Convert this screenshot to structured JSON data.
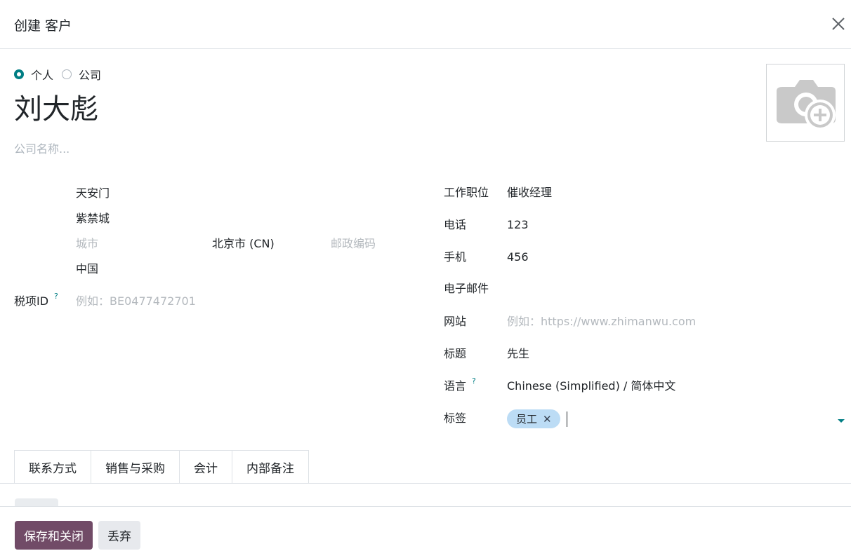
{
  "dialog": {
    "title": "创建 客户"
  },
  "type_options": [
    {
      "label": "个人",
      "selected": true
    },
    {
      "label": "公司",
      "selected": false
    }
  ],
  "name": "刘大彪",
  "company_placeholder": "公司名称...",
  "address": {
    "street": "天安门",
    "street2": "紫禁城",
    "city_placeholder": "城市",
    "state": "北京市 (CN)",
    "zip_placeholder": "邮政编码",
    "country": "中国"
  },
  "vat": {
    "label": "税项ID",
    "help": "?",
    "placeholder": "例如：BE0477472701"
  },
  "right_fields": {
    "job": {
      "label": "工作职位",
      "value": "催收经理"
    },
    "phone": {
      "label": "电话",
      "value": "123"
    },
    "mobile": {
      "label": "手机",
      "value": "456"
    },
    "email": {
      "label": "电子邮件",
      "value": ""
    },
    "website": {
      "label": "网站",
      "placeholder": "例如：https://www.zhimanwu.com"
    },
    "title": {
      "label": "标题",
      "value": "先生"
    },
    "language": {
      "label": "语言",
      "help": "?",
      "value": "Chinese (Simplified) / 简体中文"
    },
    "tags": {
      "label": "标签",
      "items": [
        "员工"
      ]
    }
  },
  "tabs": [
    "联系方式",
    "销售与采购",
    "会计",
    "内部备注"
  ],
  "footer": {
    "save_label": "保存和关闭",
    "discard_label": "丢弃"
  },
  "colors": {
    "primary": "#714b67",
    "accent": "#017e84",
    "tag_bg": "#bcdcf5"
  },
  "icons": {
    "close": "close-icon",
    "photo": "camera-plus-icon",
    "tag_remove": "close-icon",
    "dropdown": "caret-down-icon"
  }
}
